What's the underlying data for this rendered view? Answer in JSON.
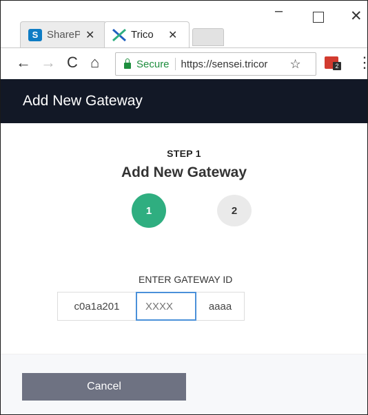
{
  "browser": {
    "tabs": [
      {
        "title": "SharePoint",
        "favicon": "sharepoint-icon"
      },
      {
        "title": "Trico",
        "favicon": "trico-x-icon"
      }
    ],
    "window_controls": {
      "minimize": "–",
      "maximize": "",
      "close": "✕"
    },
    "nav": {
      "back": "←",
      "forward": "→",
      "reload": "C",
      "home": "⌂"
    },
    "omnibox": {
      "secure_label": "Secure",
      "url": "https://sensei.tricor"
    },
    "extension_badge": "2"
  },
  "app": {
    "header_title": "Add New Gateway",
    "step_label": "STEP 1",
    "step_heading": "Add New Gateway",
    "steps": [
      "1",
      "2"
    ],
    "gateway_id": {
      "label": "ENTER GATEWAY ID",
      "segment1": "c0a1a201",
      "segment2_placeholder": "XXXX",
      "segment3": "aaaa"
    },
    "cancel_label": "Cancel"
  },
  "colors": {
    "header_bg": "#121826",
    "step_active": "#2fae80",
    "step_inactive": "#eaeaea",
    "input_focus": "#4a90d9",
    "cancel_bg": "#6e7282",
    "secure_green": "#1e8e3e"
  }
}
